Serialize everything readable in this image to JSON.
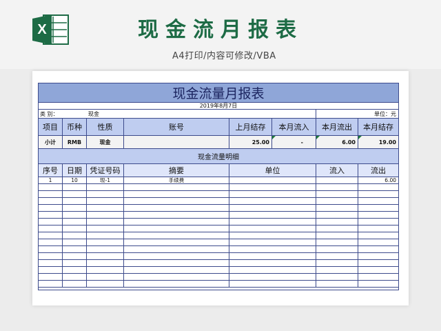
{
  "header": {
    "app_icon": "excel-icon",
    "logo_letter": "X",
    "title": "现金流月报表",
    "subtitle": "A4打印/内容可修改/VBA"
  },
  "sheet": {
    "title": "现金流量月报表",
    "date": "2019年8月7日",
    "category_label": "类    别：",
    "category_value": "现金",
    "unit_label": "单位：元",
    "columns": [
      "项目",
      "币种",
      "性质",
      "账号",
      "上月结存",
      "本月流入",
      "本月流出",
      "本月结存"
    ],
    "summary": {
      "item": "小计",
      "currency": "RMB",
      "nature": "现金",
      "account": "",
      "last_balance": "25.00",
      "inflow": "-",
      "outflow": "6.00",
      "balance": "19.00"
    },
    "section_title": "现金流量明细",
    "detail_columns": [
      "序号",
      "日期",
      "凭证号码",
      "摘要",
      "单位",
      "流入",
      "流出"
    ],
    "detail_rows": [
      {
        "no": "1",
        "date": "10",
        "voucher": "现-1",
        "summary": "手续费",
        "unit": "",
        "inflow": "",
        "outflow": "6.00"
      }
    ]
  },
  "colors": {
    "title_band": "#8fa6d8",
    "header_band": "#bfcdf0",
    "border": "#3c4a8b",
    "excel_green": "#1d6b45"
  }
}
